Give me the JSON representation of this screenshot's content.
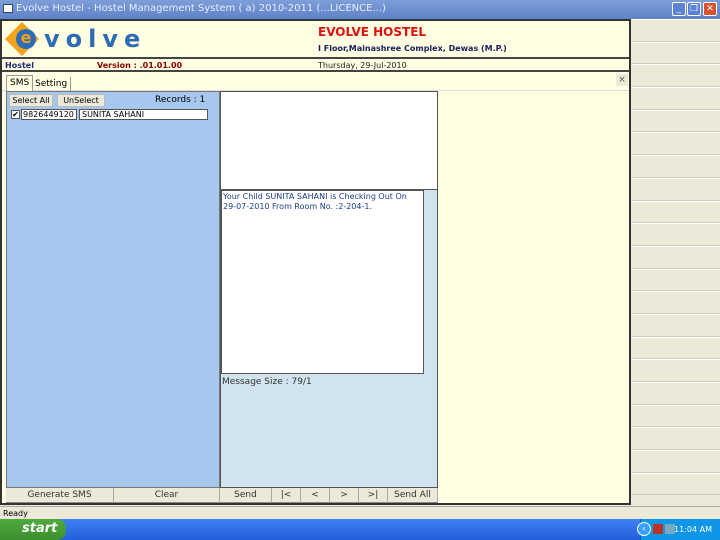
{
  "window": {
    "title": "Evolve Hostel - Hostel Management System ( a) 2010-2011 (...LICENCE...)"
  },
  "header": {
    "logo_text": "evolve",
    "name": "EVOLVE HOSTEL",
    "address": "I Floor,Mainashree Complex, Dewas (M.P.)"
  },
  "info": {
    "module": "Hostel",
    "version": "Version : .01.01.00",
    "date": "Thursday, 29-Jul-2010"
  },
  "tabs": [
    {
      "label": "SMS",
      "active": true
    },
    {
      "label": "Setting",
      "active": false
    }
  ],
  "left": {
    "select_all": "Select All",
    "unselect": "UnSelect",
    "records": "Records : 1",
    "rows": [
      {
        "checked": true,
        "phone": "9826449120",
        "name": "SUNITA  SAHANI"
      }
    ]
  },
  "message": {
    "text": "Your Child SUNITA  SAHANI is Checking Out On 29-07-2010 From Room No. :2-204-1.",
    "size": "Message Size : 79/1"
  },
  "buttons": {
    "generate": "Generate SMS",
    "clear": "Clear",
    "send": "Send",
    "first": "|<",
    "prev": "<",
    "next": ">",
    "last": ">|",
    "send_all": "Send All"
  },
  "status": "Ready",
  "taskbar": {
    "start": "start",
    "time": "11:04 AM"
  },
  "colors": {
    "left_panel": "#a6c8ee",
    "middle_panel": "#d2e3f0",
    "header_bg": "#fffde2",
    "title_red": "#dd1111"
  }
}
